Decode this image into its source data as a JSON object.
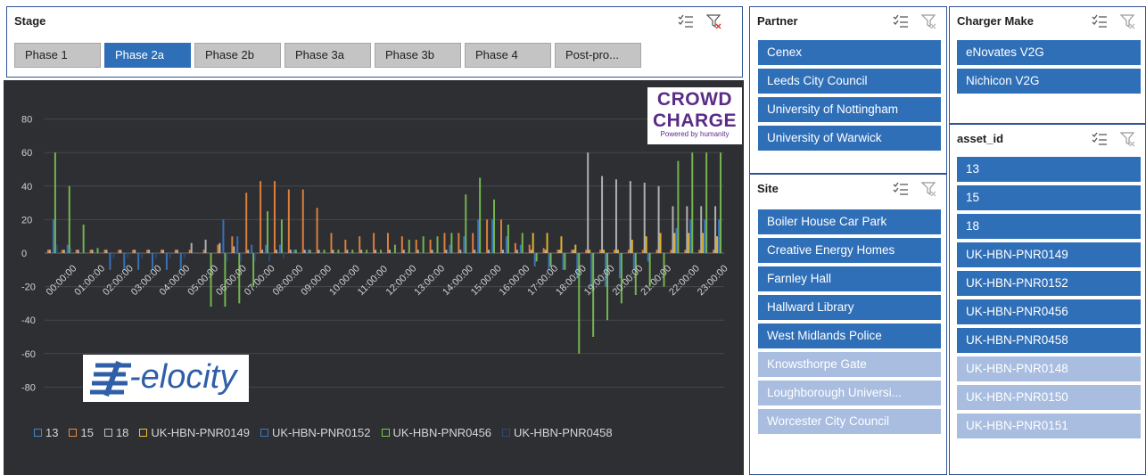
{
  "stage": {
    "title": "Stage",
    "phases": [
      "Phase 1",
      "Phase 2a",
      "Phase 2b",
      "Phase 3a",
      "Phase 3b",
      "Phase 4",
      "Post-pro..."
    ],
    "selected_index": 1
  },
  "partner": {
    "title": "Partner",
    "items": [
      {
        "label": "Cenex",
        "selected": true
      },
      {
        "label": "Leeds City Council",
        "selected": true
      },
      {
        "label": "University of Nottingham",
        "selected": true
      },
      {
        "label": "University of Warwick",
        "selected": true
      }
    ]
  },
  "site": {
    "title": "Site",
    "items": [
      {
        "label": "Boiler House Car Park",
        "selected": true
      },
      {
        "label": "Creative Energy Homes",
        "selected": true
      },
      {
        "label": "Farnley Hall",
        "selected": true
      },
      {
        "label": "Hallward Library",
        "selected": true
      },
      {
        "label": "West Midlands Police",
        "selected": true
      },
      {
        "label": "Knowsthorpe Gate",
        "selected": false
      },
      {
        "label": "Loughborough Universi...",
        "selected": false
      },
      {
        "label": "Worcester City Council",
        "selected": false
      }
    ]
  },
  "charger_make": {
    "title": "Charger Make",
    "items": [
      {
        "label": "eNovates V2G",
        "selected": true
      },
      {
        "label": "Nichicon V2G",
        "selected": true
      }
    ]
  },
  "asset_id": {
    "title": "asset_id",
    "items": [
      {
        "label": "13",
        "selected": true
      },
      {
        "label": "15",
        "selected": true
      },
      {
        "label": "18",
        "selected": true
      },
      {
        "label": "UK-HBN-PNR0149",
        "selected": true
      },
      {
        "label": "UK-HBN-PNR0152",
        "selected": true
      },
      {
        "label": "UK-HBN-PNR0456",
        "selected": true
      },
      {
        "label": "UK-HBN-PNR0458",
        "selected": true
      },
      {
        "label": "UK-HBN-PNR0148",
        "selected": false
      },
      {
        "label": "UK-HBN-PNR0150",
        "selected": false
      },
      {
        "label": "UK-HBN-PNR0151",
        "selected": false
      }
    ]
  },
  "logos": {
    "crowd_line1": "CROWD",
    "crowd_line2": "CHARGE",
    "crowd_tagline": "Powered by humanity",
    "ev_text": "-elocity"
  },
  "icons": {
    "multiselect": "multi-select-icon",
    "clear_filter": "clear-filter-icon"
  },
  "colors": {
    "selected_item": "#2f6fb8",
    "unselected_item": "#a8bde0",
    "chart_bg": "#2d2f33",
    "series_13": "#3f86d6",
    "series_15": "#f08a3c",
    "series_18": "#bfbfbf",
    "series_PNR0149": "#f2c12e",
    "series_PNR0152": "#3a78c7",
    "series_PNR0456": "#7cc451",
    "series_PNR0458": "#2b4a7a"
  },
  "chart_data": {
    "type": "bar",
    "ylim": [
      -90,
      90
    ],
    "yticks": [
      80,
      60,
      40,
      20,
      0,
      -20,
      -40,
      -60,
      -80
    ],
    "grid": true,
    "legend_position": "bottom",
    "x_labels": [
      "00:00:00",
      "01:00:00",
      "02:00:00",
      "03:00:00",
      "04:00:00",
      "05:00:00",
      "06:00:00",
      "07:00:00",
      "08:00:00",
      "09:00:00",
      "10:00:00",
      "11:00:00",
      "12:00:00",
      "13:00:00",
      "14:00:00",
      "15:00:00",
      "16:00:00",
      "17:00:00",
      "18:00:00",
      "19:00:00",
      "20:00:00",
      "21:00:00",
      "22:00:00",
      "23:00:00"
    ],
    "series": [
      {
        "name": "13",
        "color": "#3f86d6",
        "values": [
          0,
          0,
          0,
          0,
          0,
          0,
          0,
          0,
          0,
          0,
          0,
          0,
          0,
          0,
          0,
          0,
          0,
          0,
          0,
          0,
          0,
          0,
          0,
          0,
          0,
          0,
          0,
          0,
          0,
          0,
          0,
          0,
          0,
          0,
          0,
          0,
          0,
          0,
          0,
          0,
          0,
          0,
          0,
          0,
          0,
          0,
          0,
          0
        ]
      },
      {
        "name": "15",
        "color": "#f08a3c",
        "values": [
          2,
          2,
          2,
          2,
          2,
          2,
          2,
          2,
          2,
          2,
          2,
          2,
          5,
          10,
          36,
          43,
          43,
          38,
          38,
          27,
          12,
          8,
          10,
          12,
          12,
          10,
          8,
          8,
          12,
          12,
          12,
          20,
          20,
          6,
          5,
          3,
          2,
          2,
          2,
          2,
          2,
          2,
          2,
          2,
          2,
          2,
          2,
          2
        ]
      },
      {
        "name": "18",
        "color": "#bfbfbf",
        "values": [
          2,
          2,
          2,
          2,
          2,
          2,
          2,
          2,
          2,
          2,
          6,
          8,
          6,
          4,
          2,
          2,
          2,
          2,
          2,
          2,
          2,
          2,
          2,
          2,
          2,
          2,
          2,
          2,
          2,
          2,
          2,
          2,
          2,
          2,
          2,
          2,
          2,
          2,
          60,
          46,
          44,
          43,
          42,
          40,
          28,
          28,
          28,
          28
        ]
      },
      {
        "name": "UK-HBN-PNR0149",
        "color": "#f2c12e",
        "values": [
          0,
          0,
          0,
          0,
          0,
          0,
          0,
          0,
          0,
          0,
          0,
          0,
          0,
          0,
          0,
          0,
          0,
          0,
          0,
          0,
          0,
          0,
          0,
          0,
          0,
          0,
          0,
          0,
          0,
          0,
          0,
          0,
          0,
          0,
          12,
          12,
          10,
          5,
          2,
          2,
          2,
          8,
          10,
          12,
          12,
          12,
          12,
          10
        ]
      },
      {
        "name": "UK-HBN-PNR0152",
        "color": "#3a78c7",
        "values": [
          20,
          5,
          0,
          0,
          -10,
          -10,
          -10,
          -10,
          -10,
          -10,
          0,
          0,
          20,
          10,
          5,
          5,
          5,
          2,
          2,
          0,
          0,
          0,
          0,
          0,
          0,
          0,
          0,
          0,
          5,
          10,
          20,
          20,
          10,
          5,
          -8,
          -10,
          -10,
          -15,
          -20,
          -20,
          -15,
          -10,
          -5,
          0,
          15,
          20,
          20,
          20
        ]
      },
      {
        "name": "UK-HBN-PNR0456",
        "color": "#7cc451",
        "values": [
          60,
          40,
          17,
          3,
          0,
          0,
          0,
          0,
          0,
          0,
          0,
          -32,
          -32,
          -30,
          -20,
          25,
          20,
          2,
          2,
          2,
          2,
          2,
          2,
          2,
          5,
          8,
          10,
          10,
          12,
          35,
          45,
          32,
          17,
          12,
          -5,
          -8,
          -10,
          -60,
          -50,
          -40,
          -30,
          -25,
          -20,
          -20,
          55,
          60,
          60,
          60
        ]
      },
      {
        "name": "UK-HBN-PNR0458",
        "color": "#2b4a7a",
        "values": [
          5,
          3,
          0,
          0,
          -3,
          -3,
          -3,
          -3,
          -3,
          -3,
          0,
          0,
          -5,
          -5,
          -5,
          -5,
          -3,
          0,
          0,
          0,
          0,
          0,
          0,
          0,
          0,
          0,
          0,
          0,
          0,
          0,
          0,
          0,
          0,
          0,
          0,
          0,
          0,
          0,
          0,
          0,
          0,
          0,
          0,
          0,
          0,
          0,
          0,
          0
        ]
      }
    ]
  }
}
